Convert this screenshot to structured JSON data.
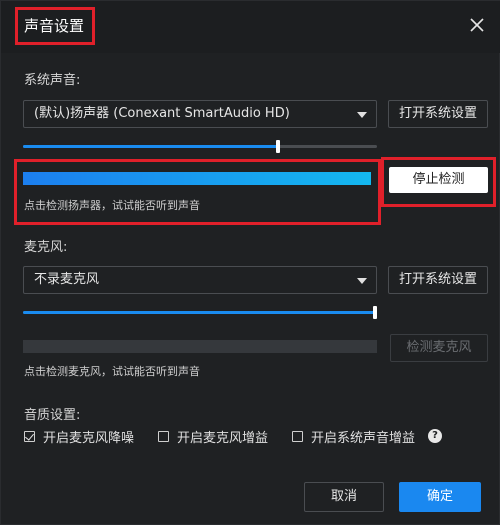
{
  "window": {
    "title": "声音设置"
  },
  "system_sound": {
    "label": "系统声音:",
    "device": "(默认)扬声器 (Conexant SmartAudio HD)",
    "open_settings": "打开系统设置",
    "volume_level": 0.72,
    "test_level": 1.0,
    "stop_test": "停止检测",
    "hint": "点击检测扬声器，试试能否听到声音"
  },
  "microphone": {
    "label": "麦克风:",
    "device": "不录麦克风",
    "open_settings": "打开系统设置",
    "volume_level": 1.0,
    "test_level": 0.0,
    "test_button": "检测麦克风",
    "hint": "点击检测麦克风，试试能否听到声音"
  },
  "quality": {
    "label": "音质设置:",
    "options": [
      {
        "label": "开启麦克风降噪",
        "checked": true
      },
      {
        "label": "开启麦克风增益",
        "checked": false
      },
      {
        "label": "开启系统声音增益",
        "checked": false
      }
    ],
    "help_glyph": "?"
  },
  "footer": {
    "cancel": "取消",
    "confirm": "确定"
  },
  "colors": {
    "accent": "#1a88f0",
    "highlight": "#e0202a",
    "background": "#1f2123"
  }
}
